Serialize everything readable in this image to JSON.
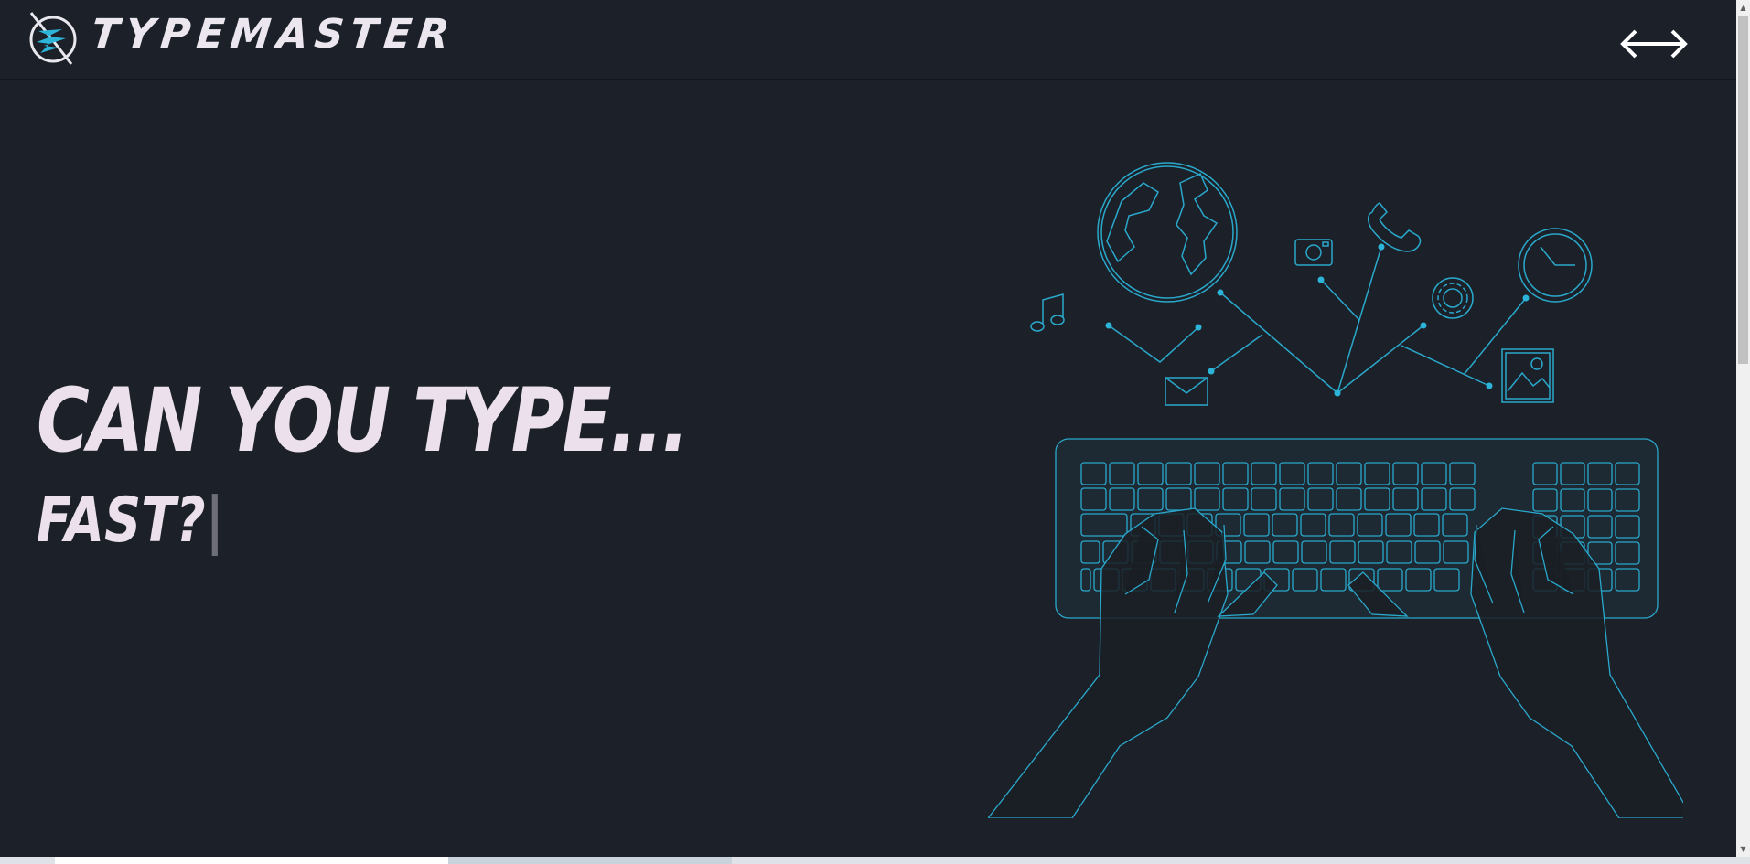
{
  "brand": {
    "name": "TYPEMASTER",
    "logo_icon": "lightning-ring-icon",
    "accent_color": "#2cb5d9"
  },
  "nav": {
    "toggle_icon": "double-arrow-icon"
  },
  "hero": {
    "line1": "CAN YOU TYPE...",
    "line2": "FAST?",
    "cursor": "|",
    "text_color": "#ebe0ec"
  },
  "illustration": {
    "description_icon": "keyboard-hands-network-illustration",
    "icons": [
      "globe-icon",
      "music-note-icon",
      "mail-icon",
      "camera-icon",
      "phone-icon",
      "gear-icon",
      "clock-icon",
      "image-icon",
      "keyboard-icon",
      "hands-icon"
    ]
  }
}
